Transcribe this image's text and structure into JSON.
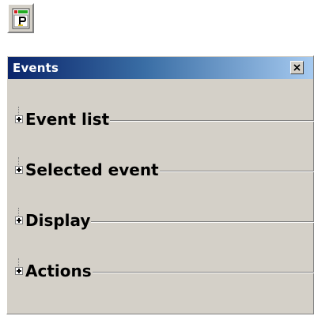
{
  "toolbar": {
    "app_icon": "event-page-icon"
  },
  "panel": {
    "title": "Events",
    "close_icon": "close-icon",
    "sections": [
      {
        "label": "Event list",
        "expanded": false
      },
      {
        "label": "Selected event",
        "expanded": false
      },
      {
        "label": "Display",
        "expanded": false
      },
      {
        "label": "Actions",
        "expanded": false
      }
    ]
  },
  "colors": {
    "panel_bg": "#d4d0c8",
    "title_gradient_start": "#0a246a",
    "title_gradient_end": "#a6caf0",
    "title_text": "#ffffff"
  }
}
